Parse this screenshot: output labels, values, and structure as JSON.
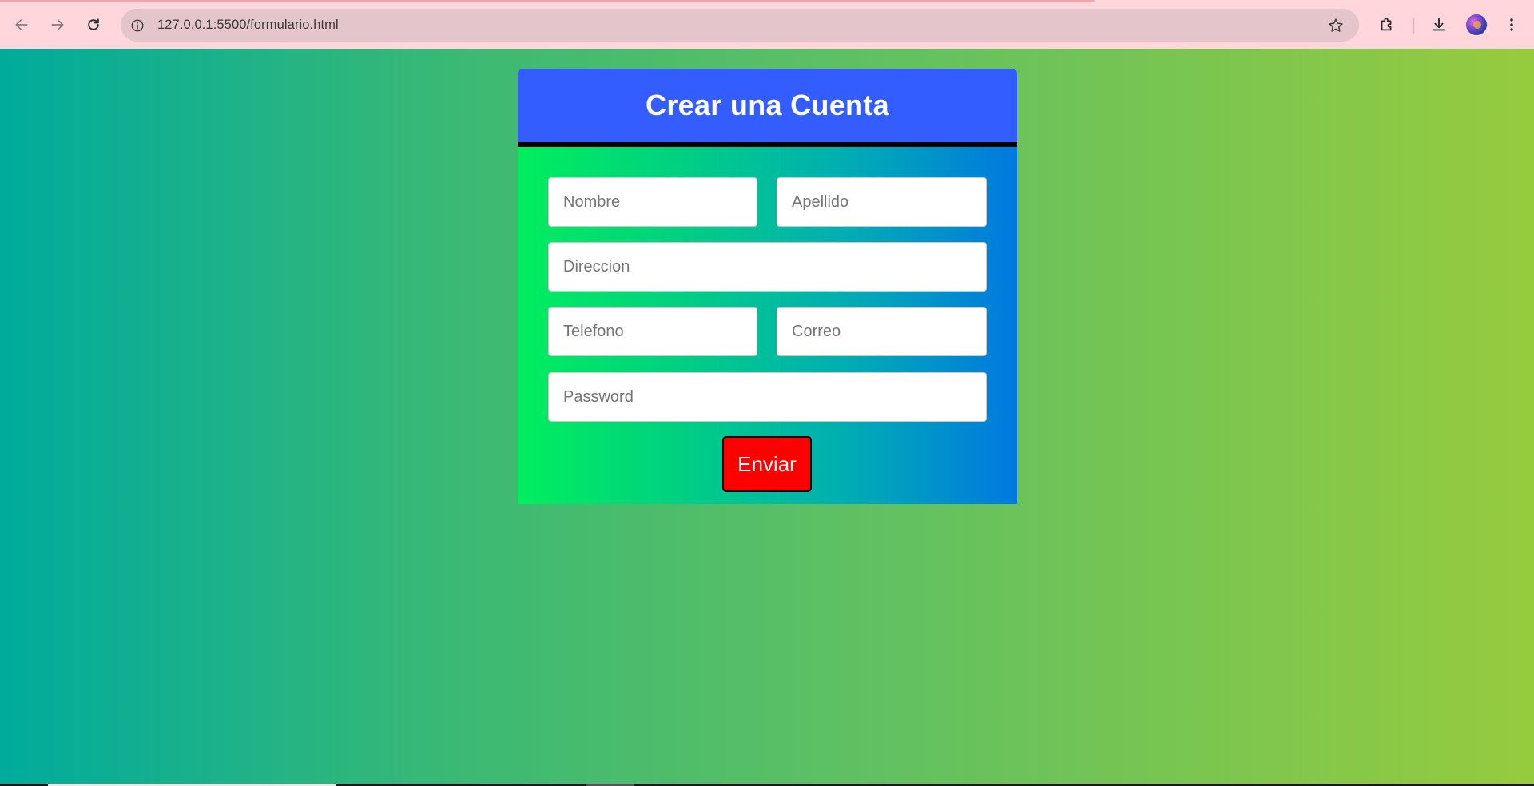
{
  "browser": {
    "url": "127.0.0.1:5500/formulario.html",
    "icons": {
      "back": "arrow-left-icon",
      "forward": "arrow-right-icon",
      "reload": "reload-icon",
      "site_info": "info-icon",
      "bookmark": "star-icon",
      "extensions": "puzzle-icon",
      "downloads": "download-icon",
      "profile": "avatar",
      "menu": "kebab-menu-icon"
    }
  },
  "form": {
    "title": "Crear una Cuenta",
    "fields": {
      "nombre_placeholder": "Nombre",
      "apellido_placeholder": "Apellido",
      "direccion_placeholder": "Direccion",
      "telefono_placeholder": "Telefono",
      "correo_placeholder": "Correo",
      "password_placeholder": "Password"
    },
    "submit_label": "Enviar"
  },
  "colors": {
    "header_bg": "#335dff",
    "submit_bg": "#ff0000",
    "chrome_bg": "#ffd6dc",
    "form_gradient_start": "#00ee5e",
    "form_gradient_end": "#0079e0",
    "page_gradient_start": "#00ab9c",
    "page_gradient_end": "#96cb3e"
  }
}
